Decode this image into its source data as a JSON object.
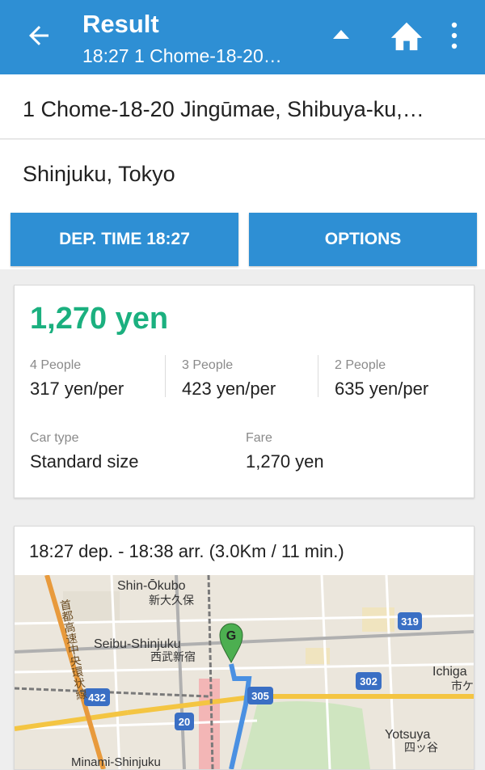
{
  "app_bar": {
    "title": "Result",
    "subtitle": "18:27 1 Chome-18-20…",
    "back_icon": "arrow-left-icon",
    "collapse_icon": "triangle-up-icon",
    "home_icon": "home-icon",
    "more_icon": "more-vertical-icon"
  },
  "origin": "1 Chome-18-20 Jingūmae, Shibuya-ku,…",
  "destination": "Shinjuku, Tokyo",
  "buttons": {
    "departure": "DEP. TIME 18:27",
    "options": "OPTIONS"
  },
  "fare_card": {
    "total": "1,270 yen",
    "split": [
      {
        "label": "4 People",
        "value": "317 yen/per"
      },
      {
        "label": "3 People",
        "value": "423 yen/per"
      },
      {
        "label": "2 People",
        "value": "635 yen/per"
      }
    ],
    "car_type_label": "Car type",
    "car_type_value": "Standard size",
    "fare_label": "Fare",
    "fare_value": "1,270 yen"
  },
  "route_card": {
    "summary": "18:27 dep. - 18:38 arr. (3.0Km / 11 min.)",
    "map": {
      "labels": {
        "shin_okubo": "Shin-Ōkubo",
        "shin_okubo_jp": "新大久保",
        "seibu_shinjuku": "Seibu-Shinjuku",
        "seibu_shinjuku_jp": "西武新宿",
        "ichigaya": "Ichiga",
        "ichigaya_jp": "市ケ",
        "yotsuya": "Yotsuya",
        "yotsuya_jp": "四ッ谷",
        "minami_shinjuku": "Minami-Shinjuku",
        "expressway_jp": "首都高速中央環状線",
        "route_319": "319",
        "route_302": "302",
        "route_305": "305",
        "route_432": "432",
        "route_20": "20",
        "goal_marker": "G"
      },
      "colors": {
        "route": "#4a90e2",
        "goal_marker": "#4caf50",
        "highway": "#f4c542",
        "station_area": "#f3b6b6"
      }
    }
  },
  "colors": {
    "primary": "#2e8fd4",
    "total_green": "#1bb07f"
  }
}
